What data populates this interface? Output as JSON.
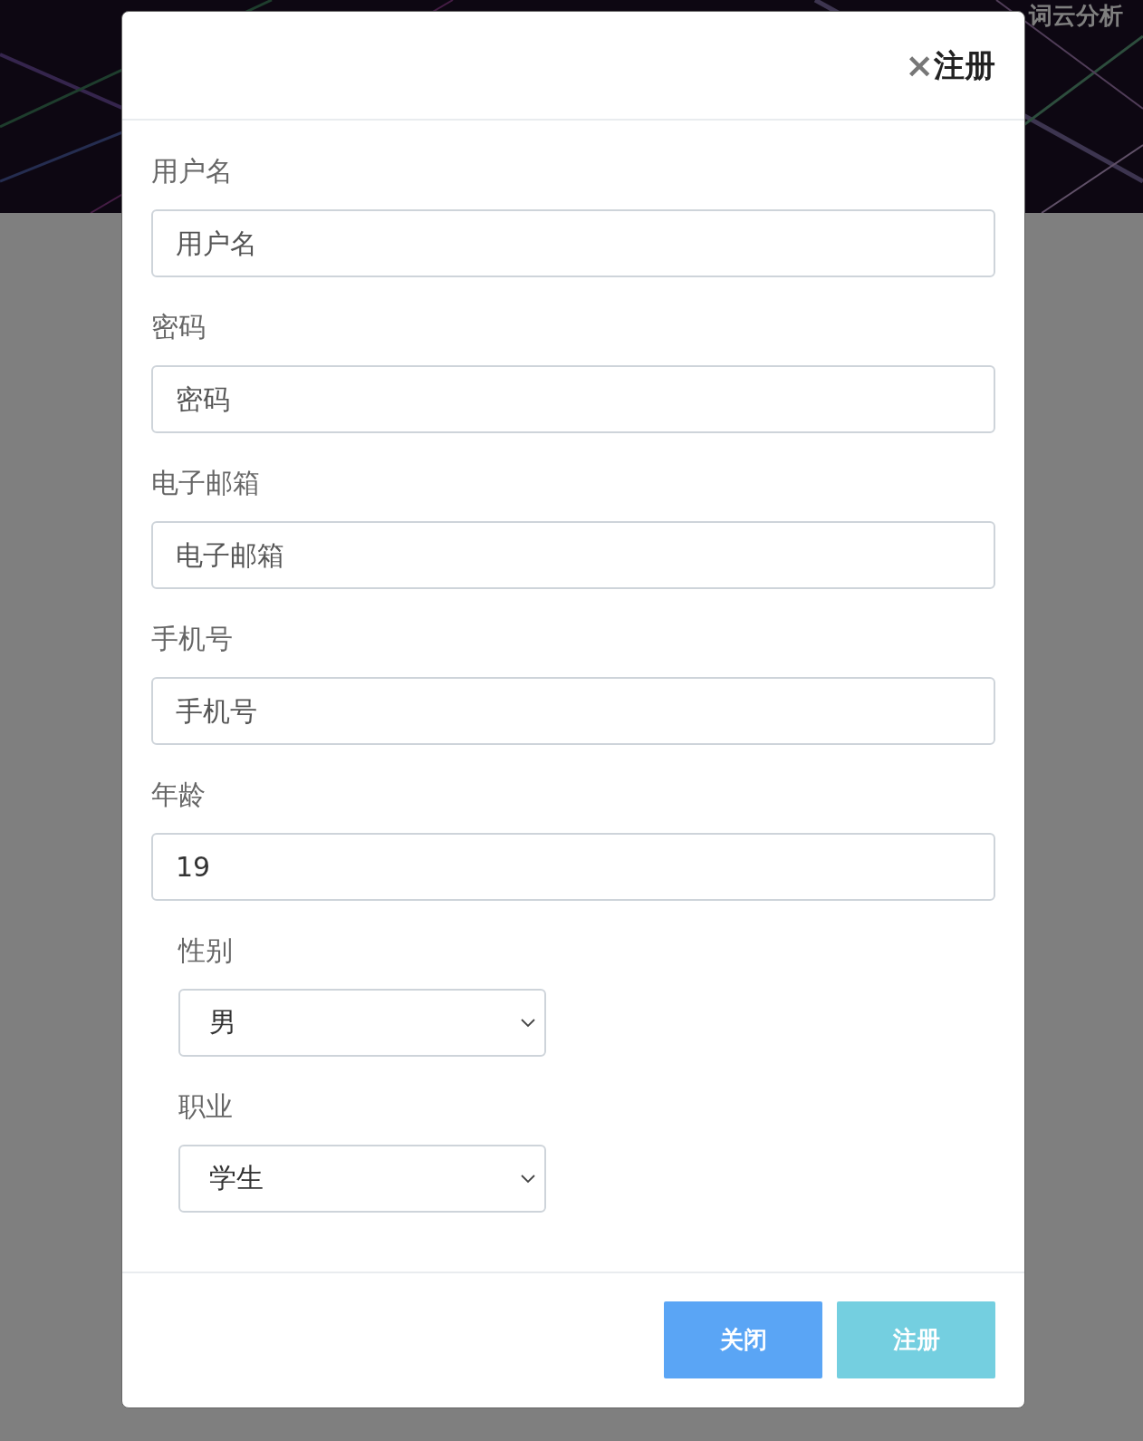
{
  "nav": [
    {
      "label": "词云分析"
    }
  ],
  "modal": {
    "close": "×",
    "title": "注册",
    "fields": [
      {
        "kind": "text",
        "label": "用户名",
        "placeholder": "用户名"
      },
      {
        "kind": "text",
        "label": "密码",
        "placeholder": "密码"
      },
      {
        "kind": "text",
        "label": "电子邮箱",
        "placeholder": "电子邮箱"
      },
      {
        "kind": "text",
        "label": "手机号",
        "placeholder": "手机号"
      },
      {
        "kind": "text",
        "label": "年龄",
        "value": "19"
      },
      {
        "kind": "select",
        "label": "性别",
        "value": "男"
      },
      {
        "kind": "select",
        "label": "职业",
        "value": "学生"
      }
    ],
    "buttons": [
      {
        "label": "关闭",
        "kind": "secondary"
      },
      {
        "label": "注册",
        "kind": "primary"
      }
    ]
  }
}
